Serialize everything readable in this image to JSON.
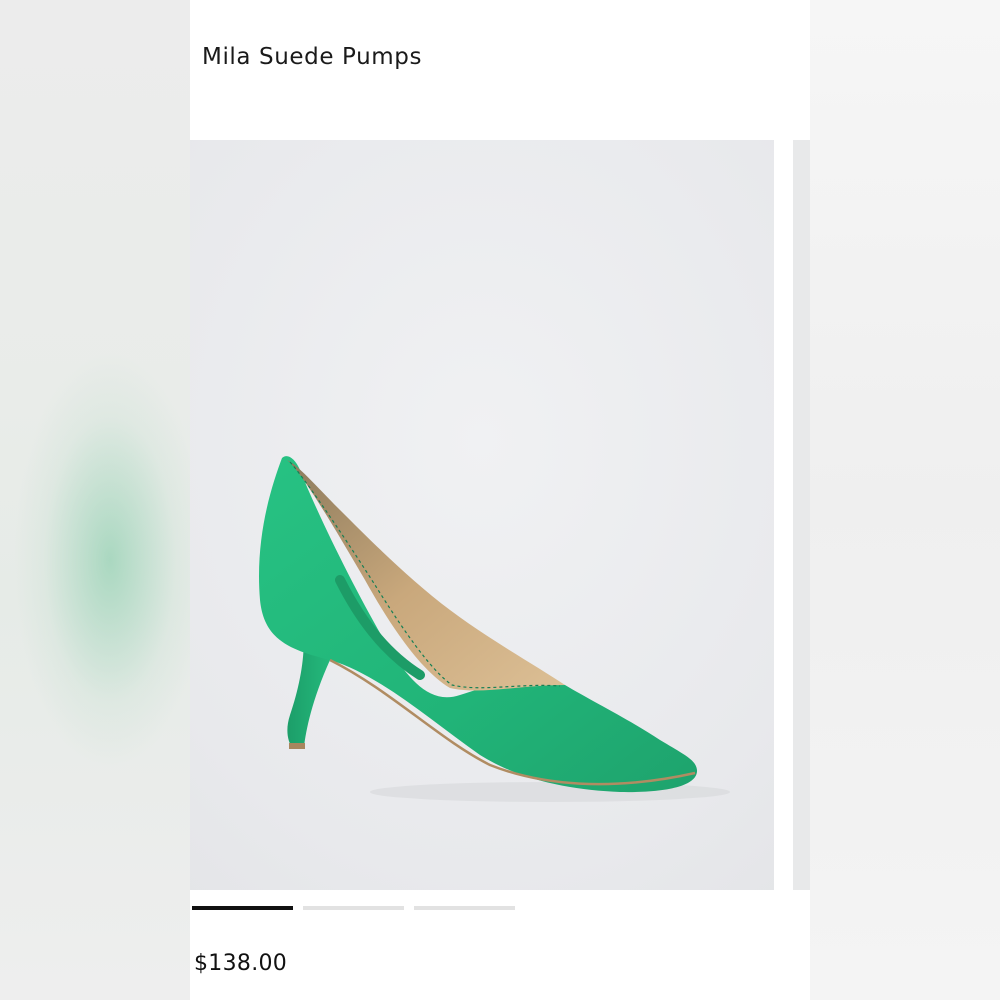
{
  "product": {
    "title": "Mila Suede Pumps",
    "price": "$138.00",
    "color_hex": "#22b97a"
  },
  "carousel": {
    "image_name": "green-suede-pump-image",
    "slide_count": 3,
    "active_index": 0
  }
}
